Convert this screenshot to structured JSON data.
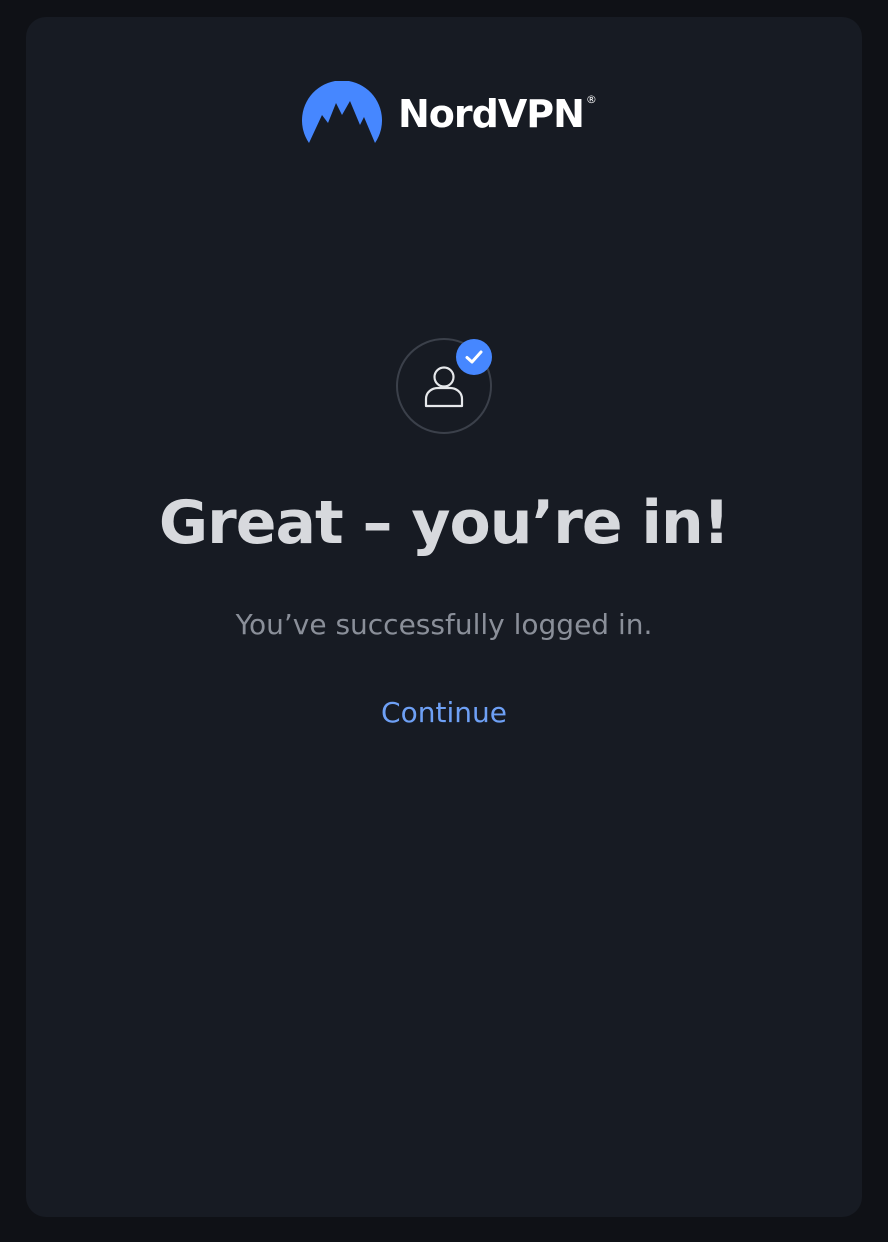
{
  "brand": {
    "name": "NordVPN",
    "registered_mark": "®",
    "logo_icon": "nordvpn-mountain-logo",
    "accent_color": "#4687ff"
  },
  "status": {
    "avatar_icon": "user-icon",
    "badge_icon": "check-icon",
    "badge_color": "#4687ff"
  },
  "main": {
    "headline": "Great – you’re in!",
    "subtext": "You’ve successfully logged in.",
    "continue_label": "Continue",
    "continue_color": "#6ea0f5"
  }
}
